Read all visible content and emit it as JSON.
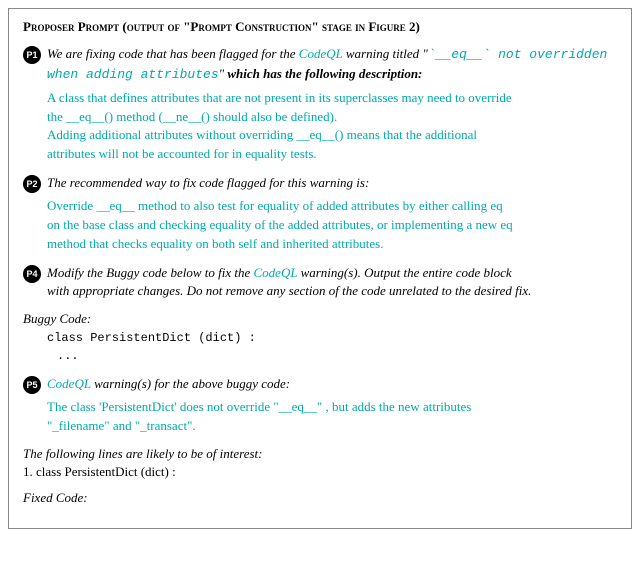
{
  "title": "Proposer Prompt (output of \"Prompt Construction\" stage in Figure 2)",
  "sections": [
    {
      "id": "p1",
      "badge": "P1",
      "lines": [
        {
          "type": "mixed",
          "segments": [
            {
              "style": "italic",
              "text": "We are fixing code that has been flagged for the "
            },
            {
              "style": "cyan-italic",
              "text": "CodeQL"
            },
            {
              "style": "italic",
              "text": " warning titled \""
            },
            {
              "style": "cyan-italic-code",
              "text": "`__eq__` not overridden when adding attributes"
            },
            {
              "style": "italic",
              "text": "\" "
            },
            {
              "style": "italic-bold",
              "text": "which has the following description:"
            }
          ]
        },
        {
          "type": "cyan",
          "text": "A class that defines attributes that are not present in its superclasses may need to override the __eq__() method (__ne__() should also be defined)."
        },
        {
          "type": "cyan",
          "text": "Adding additional attributes without overriding __eq__() means that the additional attributes will not be accounted for in equality tests."
        }
      ]
    },
    {
      "id": "p2",
      "badge": "P2",
      "lines": [
        {
          "type": "italic",
          "text": "The recommended way to fix code flagged for this warning is:"
        },
        {
          "type": "cyan",
          "text": "Override __eq__ method to also test for equality of added attributes by either calling eq on the base class and checking equality of the added attributes, or implementing a new eq method that checks equality on both self and inherited attributes."
        }
      ]
    },
    {
      "id": "p4",
      "badge": "P4",
      "lines": [
        {
          "type": "mixed",
          "segments": [
            {
              "style": "italic",
              "text": "Modify the Buggy code below to fix the "
            },
            {
              "style": "cyan-italic",
              "text": "CodeQL"
            },
            {
              "style": "italic",
              "text": " warning(s). Output the entire code block with appropriate changes. Do not remove any section of the code unrelated to the desired fix."
            }
          ]
        }
      ]
    },
    {
      "id": "buggy",
      "label": "Buggy Code:",
      "code_lines": [
        "class PersistentDict (dict) :",
        "   ..."
      ]
    },
    {
      "id": "p5",
      "badge": "P5",
      "lines": [
        {
          "type": "mixed",
          "segments": [
            {
              "style": "cyan-italic",
              "text": "CodeQL"
            },
            {
              "style": "italic",
              "text": " warning(s) for the above buggy code:"
            }
          ]
        },
        {
          "type": "cyan",
          "text": "The class 'PersistentDict' does not override \"__eq__\" , but adds the new attributes \"_filename\" and \"_transact\"."
        }
      ]
    },
    {
      "id": "following",
      "label": "The following lines are likely to be of interest:",
      "lines": [
        "1. class PersistentDict (dict) :"
      ]
    },
    {
      "id": "fixed",
      "label": "Fixed Code:"
    }
  ]
}
